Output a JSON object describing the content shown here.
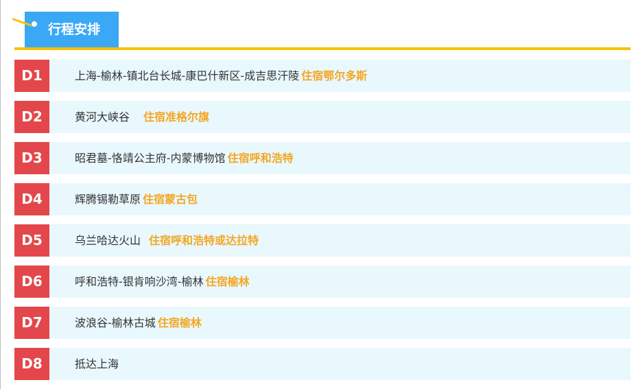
{
  "header": {
    "title": "行程安排"
  },
  "colors": {
    "tab_blue": "#3aa8f5",
    "rule_gold": "#f5c100",
    "badge_red": "#e4474b",
    "row_bg": "#e8f8fd",
    "lodging_orange": "#f5a623"
  },
  "days": [
    {
      "label": "D1",
      "route": "上海-榆林-镇北台长城-康巴什新区-成吉思汗陵",
      "lodging": "住宿鄂尔多斯"
    },
    {
      "label": "D2",
      "route": "黄河大峡谷",
      "lodging": "住宿准格尔旗"
    },
    {
      "label": "D3",
      "route": "昭君墓-恪靖公主府-内蒙博物馆",
      "lodging": "住宿呼和浩特"
    },
    {
      "label": "D4",
      "route": "辉腾锡勒草原",
      "lodging": "住宿蒙古包"
    },
    {
      "label": "D5",
      "route": "乌兰哈达火山",
      "lodging": "住宿呼和浩特或达拉特"
    },
    {
      "label": "D6",
      "route": "呼和浩特-银肯响沙湾-榆林",
      "lodging": "住宿榆林"
    },
    {
      "label": "D7",
      "route": "波浪谷-榆林古城",
      "lodging": "住宿榆林"
    },
    {
      "label": "D8",
      "route": "抵达上海",
      "lodging": ""
    }
  ]
}
